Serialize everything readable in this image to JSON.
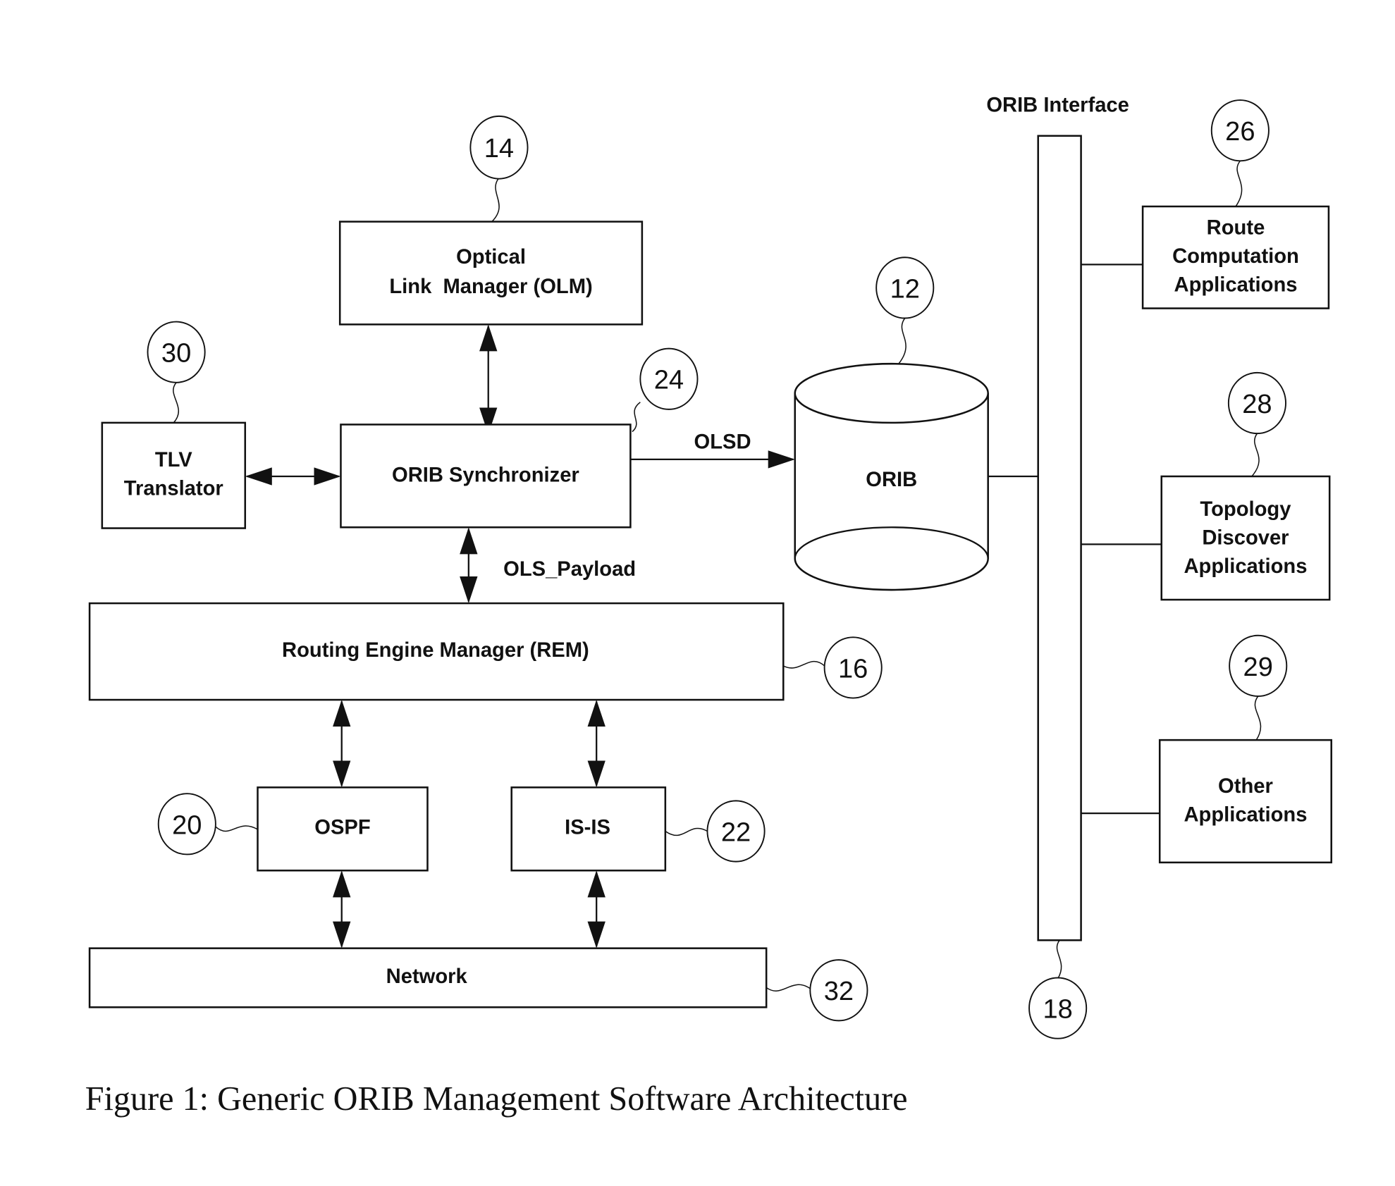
{
  "figure": {
    "caption": "Figure 1: Generic ORIB Management Software Architecture",
    "interface_label": "ORIB Interface",
    "components": {
      "olm": {
        "lines": [
          "Optical",
          "Link  Manager (OLM)"
        ],
        "ref": "14"
      },
      "tlv": {
        "lines": [
          "TLV",
          "Translator"
        ],
        "ref": "30"
      },
      "sync": {
        "label": "ORIB Synchronizer",
        "ref": "24"
      },
      "orib": {
        "label": "ORIB",
        "ref": "12"
      },
      "rem": {
        "label": "Routing Engine Manager (REM)",
        "ref": "16"
      },
      "ospf": {
        "label": "OSPF",
        "ref": "20"
      },
      "isis": {
        "label": "IS-IS",
        "ref": "22"
      },
      "network": {
        "label": "Network",
        "ref": "32"
      },
      "interface_bus": {
        "ref": "18"
      },
      "route": {
        "lines": [
          "Route",
          "Computation",
          "Applications"
        ],
        "ref": "26"
      },
      "topology": {
        "lines": [
          "Topology",
          "Discover",
          "Applications"
        ],
        "ref": "28"
      },
      "other": {
        "lines": [
          "Other",
          "Applications"
        ],
        "ref": "29"
      }
    },
    "connections": {
      "olsd_label": "OLSD",
      "payload_label": "OLS_Payload"
    }
  }
}
